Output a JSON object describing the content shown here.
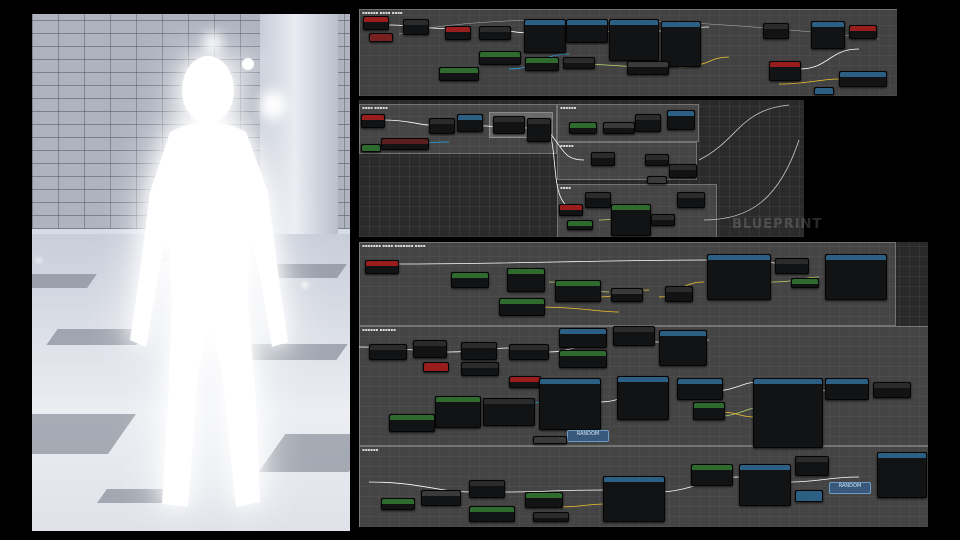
{
  "viewport": {
    "name": "Game viewport - glowing character"
  },
  "graph": {
    "watermark": "BLUEPRINT",
    "macro_labels": {
      "a": "RANDOM",
      "b": "RANDOM"
    }
  },
  "colors": {
    "background": "#000000",
    "graph_bg": "#262626",
    "event_header": "#9a1d1d",
    "function_header": "#2b5f83",
    "pure_header": "#2f6a2f",
    "exec_wire": "#ffffff",
    "float_wire": "#b7d86a",
    "vector_wire": "#f2c230",
    "object_wire": "#2ea6e6"
  }
}
